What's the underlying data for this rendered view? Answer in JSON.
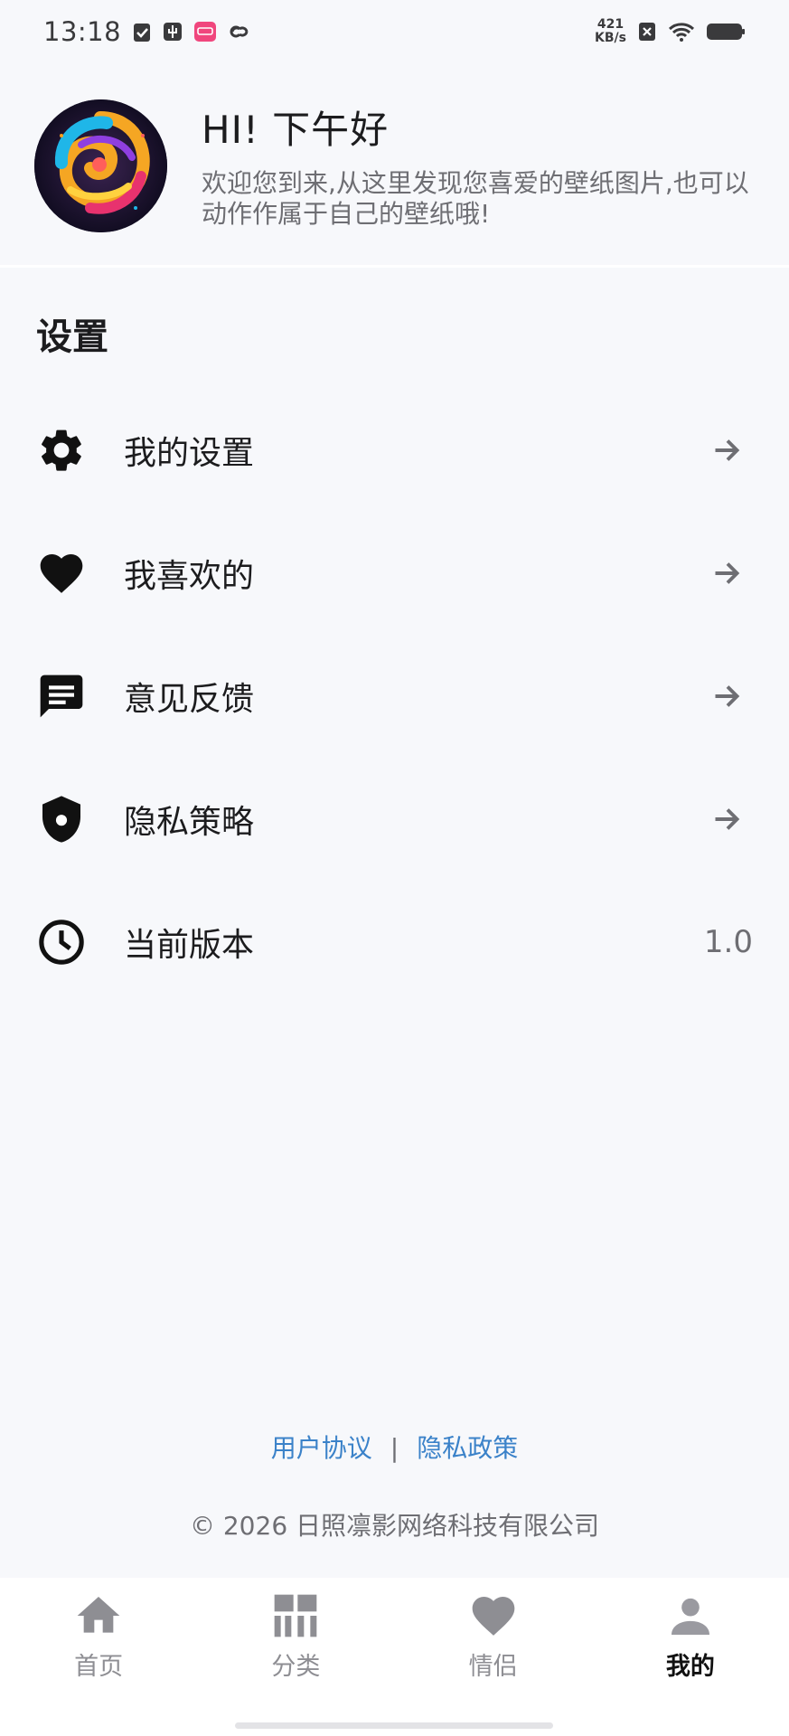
{
  "status_bar": {
    "time": "13:18",
    "network_speed_value": "421",
    "network_speed_unit": "KB/s",
    "icons": [
      "check-badge-icon",
      "usb-icon",
      "app-badge-icon",
      "link-icon",
      "sim-off-icon",
      "wifi-icon",
      "battery-icon"
    ]
  },
  "header": {
    "greeting": "HI! 下午好",
    "welcome_text": "欢迎您到来,从这里发现您喜爱的壁纸图片,也可以动作作属于自己的壁纸哦!"
  },
  "settings": {
    "title": "设置",
    "items": [
      {
        "label": "我的设置",
        "icon": "gear-icon",
        "trailing": "arrow-right-icon"
      },
      {
        "label": "我喜欢的",
        "icon": "heart-icon",
        "trailing": "arrow-right-icon"
      },
      {
        "label": "意见反馈",
        "icon": "feedback-icon",
        "trailing": "arrow-right-icon"
      },
      {
        "label": "隐私策略",
        "icon": "shield-icon",
        "trailing": "arrow-right-icon"
      },
      {
        "label": "当前版本",
        "icon": "clock-icon",
        "value": "1.0"
      }
    ]
  },
  "footer": {
    "user_agreement": "用户协议",
    "separator": "|",
    "privacy_policy": "隐私政策",
    "copyright": "© 2026 日照凛影网络科技有限公司"
  },
  "bottom_nav": {
    "items": [
      {
        "label": "首页",
        "icon": "home-icon",
        "active": false
      },
      {
        "label": "分类",
        "icon": "category-icon",
        "active": false
      },
      {
        "label": "情侣",
        "icon": "heart-icon",
        "active": false
      },
      {
        "label": "我的",
        "icon": "person-icon",
        "active": true
      }
    ]
  },
  "colors": {
    "background": "#f7f8fb",
    "link": "#3b82c9",
    "text_primary": "#1c1c1e",
    "text_secondary": "#6e6e73",
    "nav_inactive": "#8e8e93"
  }
}
